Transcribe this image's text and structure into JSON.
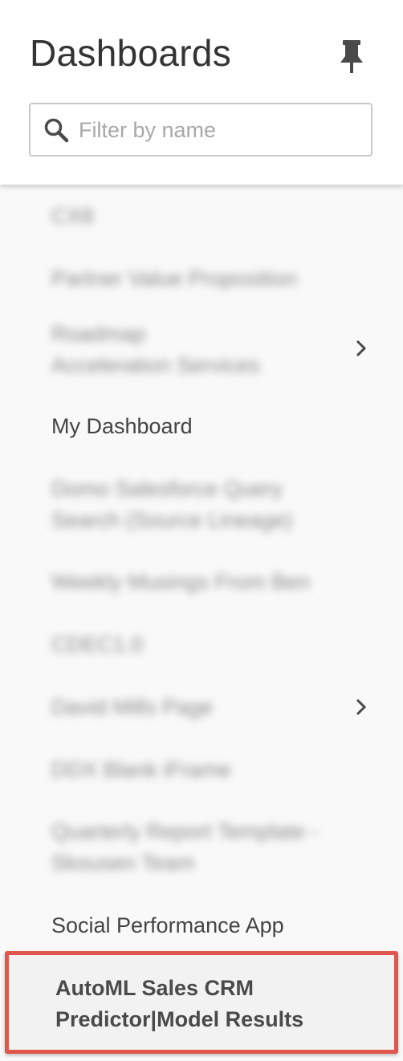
{
  "header": {
    "title": "Dashboards",
    "pin_icon": "pin-icon"
  },
  "search": {
    "placeholder": "Filter by name",
    "value": "",
    "icon": "search-icon"
  },
  "items": [
    {
      "label": "CX8",
      "blurred": true
    },
    {
      "label": "Partner Value Proposition",
      "blurred": true
    },
    {
      "label": "Roadmap\nAcceleration Services",
      "blurred": true,
      "has_children": true
    },
    {
      "label": "My Dashboard",
      "blurred": false
    },
    {
      "label": "Domo Salesforce Query\nSearch (Source Lineage)",
      "blurred": true
    },
    {
      "label": "Weekly Musings From Ben",
      "blurred": true
    },
    {
      "label": "CDEC1.0",
      "blurred": true
    },
    {
      "label": "David Mills Page",
      "blurred": true,
      "has_children": true
    },
    {
      "label": "DDX Blank iFrame",
      "blurred": true
    },
    {
      "label": "Quarterly Report Template -\nSkousen Team",
      "blurred": true
    },
    {
      "label": "Social Performance App",
      "blurred": false
    }
  ],
  "selected_item": {
    "line1": "AutoML Sales CRM",
    "line2": "Predictor|Model Results"
  },
  "colors": {
    "highlight_border": "#e1564b",
    "text": "#444444",
    "icon": "#4a4a4a"
  }
}
